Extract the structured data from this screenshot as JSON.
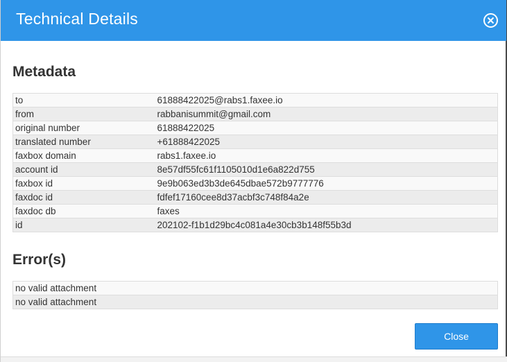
{
  "header": {
    "title": "Technical Details"
  },
  "metadata": {
    "title": "Metadata",
    "rows": [
      {
        "key": "to",
        "value": "61888422025@rabs1.faxee.io"
      },
      {
        "key": "from",
        "value": "rabbanisummit@gmail.com"
      },
      {
        "key": "original number",
        "value": "61888422025"
      },
      {
        "key": "translated number",
        "value": "+61888422025"
      },
      {
        "key": "faxbox domain",
        "value": "rabs1.faxee.io"
      },
      {
        "key": "account id",
        "value": "8e57df55fc61f1105010d1e6a822d755"
      },
      {
        "key": "faxbox id",
        "value": "9e9b063ed3b3de645dbae572b9777776"
      },
      {
        "key": "faxdoc id",
        "value": "fdfef17160cee8d37acbf3c748f84a2e"
      },
      {
        "key": "faxdoc db",
        "value": "faxes"
      },
      {
        "key": "id",
        "value": "202102-f1b1d29bc4c081a4e30cb3b148f55b3d"
      }
    ]
  },
  "errors": {
    "title": "Error(s)",
    "items": [
      "no valid attachment",
      "no valid attachment"
    ]
  },
  "footer": {
    "close_label": "Close"
  },
  "icons": {
    "close": "close-circle-icon"
  },
  "colors": {
    "accent": "#2f95e8",
    "text": "#333333"
  }
}
